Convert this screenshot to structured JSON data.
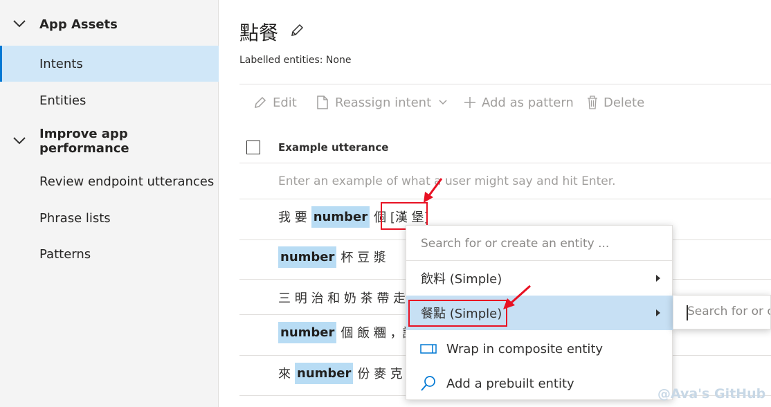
{
  "sidebar": {
    "groups": [
      {
        "label": "App Assets"
      },
      {
        "label": "Improve app performance"
      }
    ],
    "items": [
      {
        "label": "Intents"
      },
      {
        "label": "Entities"
      },
      {
        "label": "Review endpoint utterances"
      },
      {
        "label": "Phrase lists"
      },
      {
        "label": "Patterns"
      }
    ]
  },
  "main": {
    "title": "點餐",
    "labelled_entities": "Labelled entities: None",
    "toolbar": {
      "edit": "Edit",
      "reassign": "Reassign intent",
      "add_pattern": "Add as pattern",
      "delete": "Delete"
    },
    "table": {
      "header": "Example utterance",
      "input_placeholder": "Enter an example of what a user might say and hit Enter.",
      "rows": [
        {
          "pre": "我 要",
          "entity": "number",
          "post": "個 [漢 堡]"
        },
        {
          "pre": "",
          "entity": "number",
          "post": "杯 豆 漿"
        },
        {
          "pre": "三 明 治 和 奶 茶 帶 走",
          "entity": "",
          "post": ""
        },
        {
          "pre": "",
          "entity": "number",
          "post": "個 飯 糰 ，請"
        },
        {
          "pre": "來",
          "entity": "number",
          "post": "份 麥 克 雞"
        }
      ]
    }
  },
  "context_menu": {
    "search_placeholder": "Search for or create an entity ...",
    "items": [
      {
        "label": "飲料 (Simple)"
      },
      {
        "label": "餐點 (Simple)"
      },
      {
        "label": "Wrap in composite entity"
      },
      {
        "label": "Add a prebuilt entity"
      }
    ],
    "submenu_placeholder": "Search for or c"
  },
  "watermark": "@Ava's GitHub",
  "colors": {
    "accent": "#0078d4",
    "entity_highlight": "#b8dcf4",
    "annotation_red": "#e81123"
  }
}
